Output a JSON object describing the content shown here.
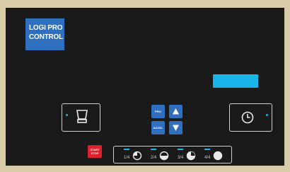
{
  "brand": {
    "line1": "LOGI PRO",
    "line2": "CONTROL"
  },
  "buttons": {
    "pro": "PRO",
    "accel": "ACCEL",
    "start_line1": "START",
    "start_line2": "STOP"
  },
  "speeds": [
    {
      "label": "1/4",
      "fill": 0.25
    },
    {
      "label": "2/4",
      "fill": 0.5
    },
    {
      "label": "3/4",
      "fill": 0.75
    },
    {
      "label": "4/4",
      "fill": 1.0
    }
  ],
  "icons": {
    "left_selector": "blender-jar-icon",
    "right_selector": "timer-clock-icon",
    "up": "arrow-up-icon",
    "down": "arrow-down-icon"
  },
  "colors": {
    "panel": "#1a1a1a",
    "frame": "#d8cca8",
    "accent_blue": "#2f6fc0",
    "display_cyan": "#18b4e8",
    "start_red": "#e0202a"
  }
}
